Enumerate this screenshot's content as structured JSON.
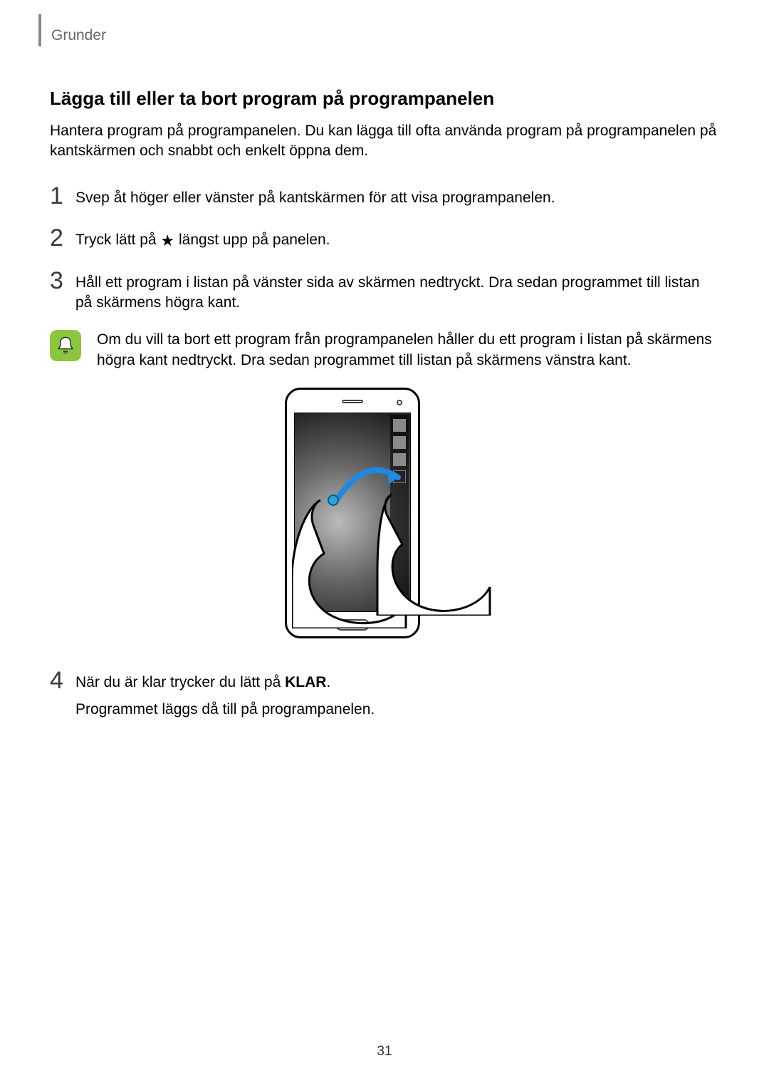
{
  "header": {
    "section": "Grunder"
  },
  "page_number": "31",
  "heading": "Lägga till eller ta bort program på programpanelen",
  "intro": "Hantera program på programpanelen. Du kan lägga till ofta använda program på programpanelen på kantskärmen och snabbt och enkelt öppna dem.",
  "steps": {
    "s1": {
      "num": "1",
      "text": "Svep åt höger eller vänster på kantskärmen för att visa programpanelen."
    },
    "s2": {
      "num": "2",
      "pre": "Tryck lätt på ",
      "post": " längst upp på panelen."
    },
    "s3": {
      "num": "3",
      "text": "Håll ett program i listan på vänster sida av skärmen nedtryckt. Dra sedan programmet till listan på skärmens högra kant."
    },
    "s4": {
      "num": "4",
      "line1_pre": "När du är klar trycker du lätt på ",
      "line1_bold": "KLAR",
      "line1_post": ".",
      "line2": "Programmet läggs då till på programpanelen."
    }
  },
  "note": {
    "text": "Om du vill ta bort ett program från programpanelen håller du ett program i listan på skärmens högra kant nedtryckt. Dra sedan programmet till listan på skärmens vänstra kant."
  }
}
